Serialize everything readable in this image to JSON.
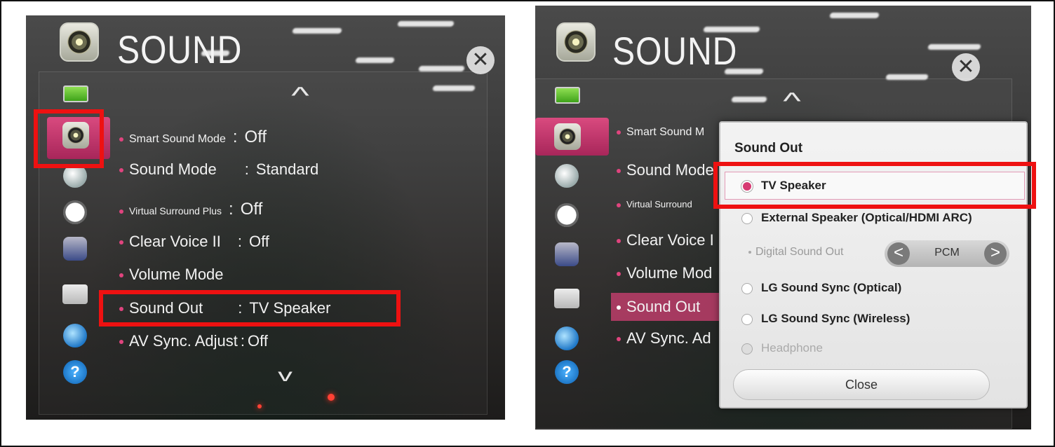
{
  "left_screen": {
    "title": "SOUND",
    "close_glyph": "✕",
    "scroll_up_glyph": "^",
    "scroll_down_glyph": "v",
    "help_glyph": "?",
    "menu": [
      {
        "label": "Smart Sound Mode",
        "value": "Off"
      },
      {
        "label": "Sound Mode",
        "value": "Standard"
      },
      {
        "label": "Virtual Surround Plus",
        "value": "Off"
      },
      {
        "label": "Clear Voice II",
        "value": "Off"
      },
      {
        "label": "Volume Mode",
        "value": ""
      },
      {
        "label": "Sound Out",
        "value": "TV Speaker"
      },
      {
        "label": "AV Sync. Adjust",
        "value": "Off"
      }
    ],
    "sidebar_icons": [
      "tv-icon",
      "sound-icon",
      "satellite-icon",
      "clock-icon",
      "lock-icon",
      "toolbox-icon",
      "globe-icon",
      "help-icon"
    ],
    "selected_sidebar": "sound-icon"
  },
  "right_screen": {
    "title": "SOUND",
    "close_glyph": "✕",
    "scroll_up_glyph": "^",
    "help_glyph": "?",
    "menu_visible": [
      {
        "label": "Smart Sound M"
      },
      {
        "label": "Sound Mode"
      },
      {
        "label": "Virtual Surround"
      },
      {
        "label": "Clear Voice I"
      },
      {
        "label": "Volume Mod"
      },
      {
        "label": "Sound Out"
      },
      {
        "label": "AV Sync. Ad"
      }
    ],
    "popup": {
      "title": "Sound Out",
      "options": [
        {
          "label": "TV Speaker",
          "selected": true
        },
        {
          "label": "External Speaker (Optical/HDMI ARC)",
          "selected": false
        },
        {
          "label": "LG Sound Sync (Optical)",
          "selected": false
        },
        {
          "label": "LG Sound Sync (Wireless)",
          "selected": false
        },
        {
          "label": "Headphone",
          "selected": false
        }
      ],
      "digital_sound_out": {
        "label": "Digital Sound Out",
        "value": "PCM",
        "prev": "<",
        "next": ">"
      },
      "close_label": "Close"
    }
  },
  "colors": {
    "highlight_red": "#ee1111",
    "accent_pink": "#d63a72"
  }
}
